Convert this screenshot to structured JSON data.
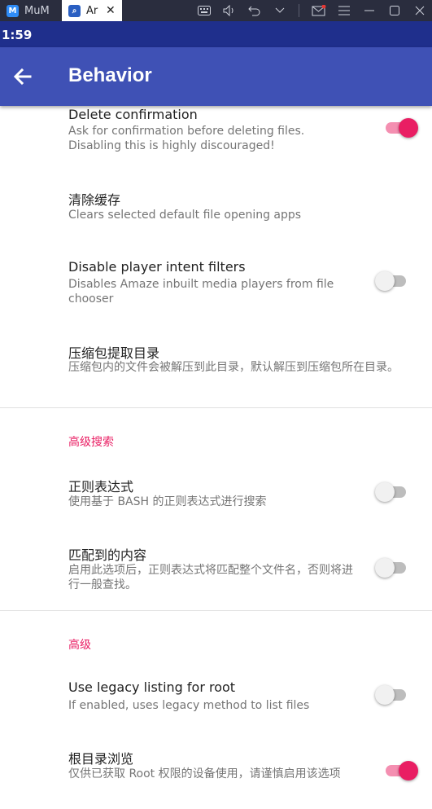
{
  "host": {
    "tabs": [
      {
        "label": "MuMu",
        "icon": "mumu-app-icon"
      },
      {
        "label": "Ar",
        "icon": "amaze-app-icon"
      }
    ]
  },
  "status_bar": {
    "time": "1:59"
  },
  "app_bar": {
    "title": "Behavior",
    "back_icon": "arrow-back-icon"
  },
  "preferences": [
    {
      "title": "Delete confirmation",
      "summary": "Ask for confirmation before deleting files. Disabling this is highly discouraged!",
      "toggle": true
    },
    {
      "title": "清除缓存",
      "summary": "Clears selected default file opening apps"
    },
    {
      "title": "Disable player intent filters",
      "summary": "Disables Amaze inbuilt media players from file chooser",
      "toggle": false
    },
    {
      "title": "压缩包提取目录",
      "summary": "压缩包内的文件会被解压到此目录，默认解压到压缩包所在目录。"
    }
  ],
  "sections": [
    {
      "header": "高级搜索",
      "items": [
        {
          "title": "正则表达式",
          "summary": "使用基于 BASH 的正则表达式进行搜索",
          "toggle": false
        },
        {
          "title": "匹配到的内容",
          "summary": "启用此选项后，正则表达式将匹配整个文件名，否则将进行一般查找。",
          "toggle": false
        }
      ]
    },
    {
      "header": "高级",
      "items": [
        {
          "title": "Use legacy listing for root",
          "summary": "If enabled, uses legacy method to list files",
          "toggle": false
        },
        {
          "title": "根目录浏览",
          "summary": "仅供已获取 Root 权限的设备使用，请谨慎启用该选项",
          "toggle": true
        }
      ]
    }
  ],
  "colors": {
    "primary": "#3f51b5",
    "status": "#1f2f8c",
    "accent": "#e91e63"
  }
}
